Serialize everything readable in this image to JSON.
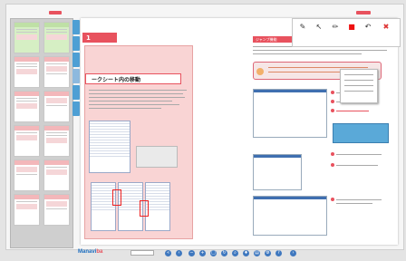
{
  "app": {
    "name": "Manavi",
    "name_suffix": "ba"
  },
  "left_page": {
    "chapter_number": "1",
    "title": "ークシート内の移動"
  },
  "right_page": {
    "section_heading": "ジャンプ機能"
  },
  "toolbar": {
    "tools": [
      {
        "icon": "pen-icon",
        "glyph": "✎",
        "label": ""
      },
      {
        "icon": "cursor-icon",
        "glyph": "↖",
        "label": ""
      },
      {
        "icon": "marker-icon",
        "glyph": "✏",
        "label": ""
      },
      {
        "icon": "color-swatch-icon",
        "glyph": "■",
        "label": ""
      },
      {
        "icon": "undo-icon",
        "glyph": "↶",
        "label": ""
      },
      {
        "icon": "delete-icon",
        "glyph": "✖",
        "label": ""
      }
    ],
    "accent_color": "#e8525e"
  },
  "bottom_bar": {
    "page_field": "",
    "icons": [
      "first-page-icon",
      "prev-page-icon",
      "zoom-out-icon",
      "zoom-in-icon",
      "fit-icon",
      "rotate-icon",
      "search-icon",
      "bookmark-icon",
      "print-icon",
      "settings-icon",
      "help-icon",
      "next-page-icon"
    ]
  },
  "colors": {
    "accent": "#e8525e",
    "tab_blue": "#4e9fd4",
    "pink_panel": "#f9d4d4"
  }
}
